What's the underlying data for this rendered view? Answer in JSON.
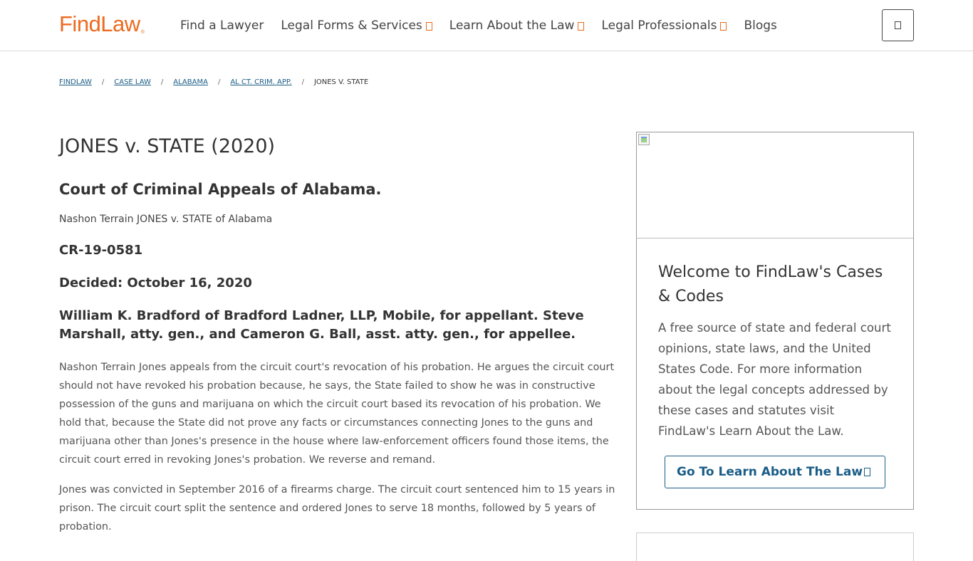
{
  "header": {
    "logo": "FindLaw",
    "logo_mark": "®",
    "nav": [
      {
        "label": "Find a Lawyer",
        "has_dropdown": false
      },
      {
        "label": "Legal Forms & Services",
        "has_dropdown": true
      },
      {
        "label": "Learn About the Law",
        "has_dropdown": true
      },
      {
        "label": "Legal Professionals",
        "has_dropdown": true
      },
      {
        "label": "Blogs",
        "has_dropdown": false
      }
    ],
    "menu_icon": "menu-icon",
    "brand_color": "#ec6b1f"
  },
  "breadcrumb": {
    "items": [
      "FINDLAW",
      "CASE LAW",
      "ALABAMA",
      "AL CT. CRIM. APP."
    ],
    "separator": "/",
    "current": "JONES V. STATE",
    "link_color": "#1a5d87"
  },
  "case": {
    "title": "JONES v. STATE (2020)",
    "court": "Court of Criminal Appeals of Alabama.",
    "parties": "Nashon Terrain JONES v. STATE of Alabama",
    "docket": "CR-19-0581",
    "decided": "Decided: October 16, 2020",
    "counsel": "William K. Bradford of Bradford Ladner, LLP, Mobile, for appellant. Steve Marshall, atty. gen., and Cameron G. Ball, asst. atty. gen., for appellee.",
    "paragraphs": [
      "Nashon Terrain Jones appeals from the circuit court's revocation of his probation. He argues the circuit court should not have revoked his probation because, he says, the State failed to show he was in constructive possession of the guns and marijuana on which the circuit court based its revocation of his probation. We hold that, because the State did not prove any facts or circumstances connecting Jones to the guns and marijuana other than Jones's presence in the house where law-enforcement officers found those items, the circuit court erred in revoking Jones's probation. We reverse and remand.",
      "Jones was convicted in September 2016 of a firearms charge. The circuit court sentenced him to 15 years in prison. The circuit court split the sentence and ordered Jones to serve 18 months, followed by 5 years of probation."
    ]
  },
  "sidebar": {
    "title": "Welcome to FindLaw's Cases & Codes",
    "text": "A free source of state and federal court opinions, state laws, and the United States Code. For more information about the legal concepts addressed by these cases and statutes visit FindLaw's Learn About the Law.",
    "button_label": "Go To Learn About The Law",
    "button_color": "#1a5d87"
  }
}
